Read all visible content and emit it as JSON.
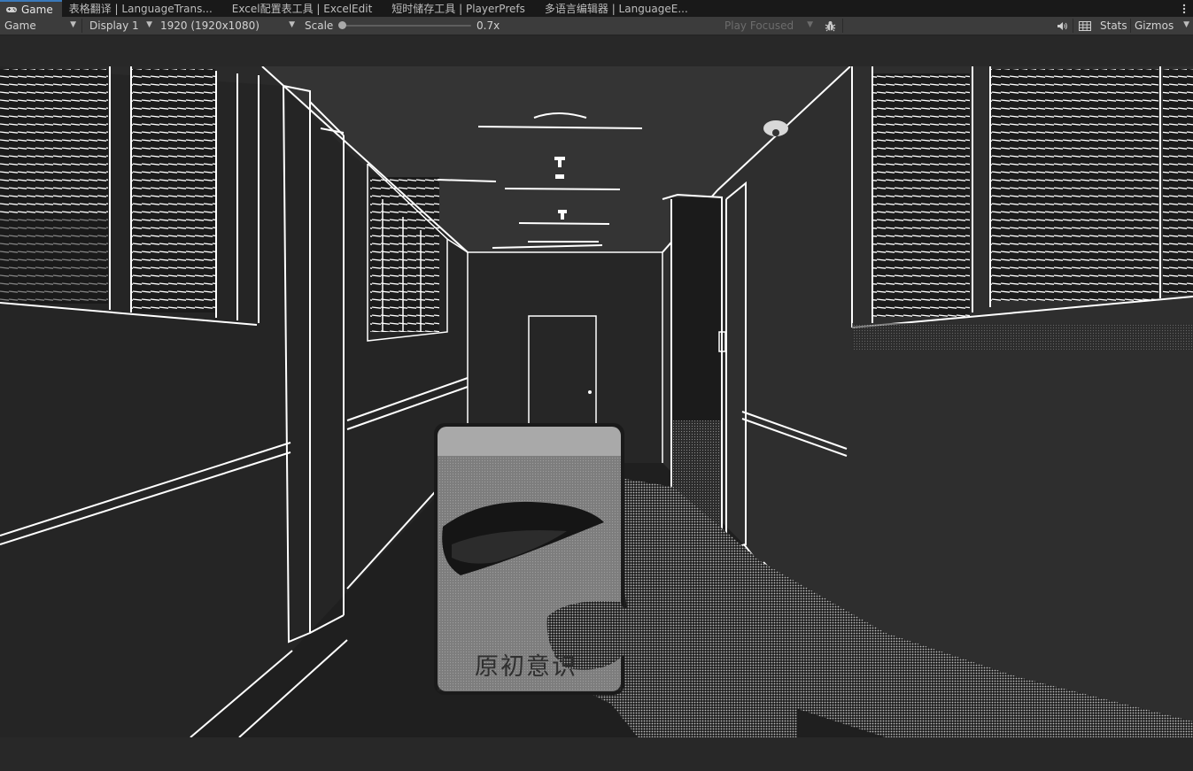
{
  "tabs": [
    {
      "label": "Game",
      "icon": "gamepad-icon",
      "active": true
    },
    {
      "label": "表格翻译 | LanguageTrans..."
    },
    {
      "label": "Excel配置表工具 | ExcelEdit"
    },
    {
      "label": "短时储存工具 | PlayerPrefs"
    },
    {
      "label": "多语言编辑器 | LanguageE..."
    }
  ],
  "toolbar": {
    "view_mode": "Game",
    "display": "Display 1",
    "resolution": "1920 (1920x1080)",
    "scale_label": "Scale",
    "scale_value": "0.7x",
    "scale_fraction": 0.0,
    "play_mode": "Play Focused",
    "stats": "Stats",
    "gizmos": "Gizmos"
  },
  "scene": {
    "card_text": "原初意识"
  },
  "colors": {
    "tab_accent": "#3a79bb",
    "scene_lines": "#ffffff",
    "scene_bg": "#2a2a2a"
  }
}
